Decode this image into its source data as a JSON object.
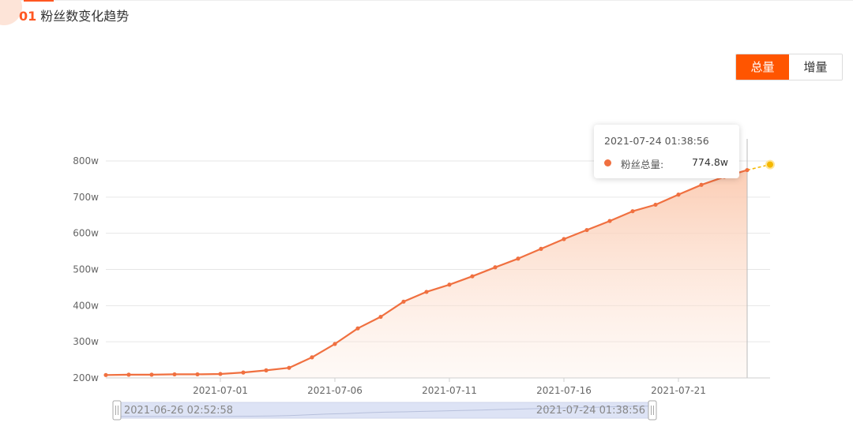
{
  "section": {
    "number": "01",
    "title": "粉丝数变化趋势"
  },
  "toggle": {
    "total_label": "总量",
    "increment_label": "增量",
    "active": "总量"
  },
  "tooltip": {
    "time": "2021-07-24 01:38:56",
    "series_name": "粉丝总量:",
    "value": "774.8w"
  },
  "datazoom": {
    "start_label": "2021-06-26 02:52:58",
    "end_label": "2021-07-24 01:38:56"
  },
  "colors": {
    "accent": "#ff5500",
    "line": "#f07040",
    "area_top": "#fbcab0",
    "highlight": "#f5b800"
  },
  "chart_data": {
    "type": "area",
    "title": "",
    "xlabel": "",
    "ylabel": "",
    "ylim": [
      200,
      800
    ],
    "y_ticks": [
      200,
      300,
      400,
      500,
      600,
      700,
      800
    ],
    "y_tick_labels": [
      "200w",
      "300w",
      "400w",
      "500w",
      "600w",
      "700w",
      "800w"
    ],
    "x_tick_labels": [
      "2021-07-01",
      "2021-07-06",
      "2021-07-11",
      "2021-07-16",
      "2021-07-21"
    ],
    "x_tick_days": [
      5,
      10,
      15,
      20,
      25
    ],
    "grid": true,
    "series": [
      {
        "name": "粉丝总量",
        "days": [
          0,
          1,
          2,
          3,
          4,
          5,
          6,
          7,
          8,
          9,
          10,
          11,
          12,
          13,
          14,
          15,
          16,
          17,
          18,
          19,
          20,
          21,
          22,
          23,
          24,
          25,
          26,
          27,
          28
        ],
        "values": [
          208,
          209,
          209,
          210,
          210,
          211,
          215,
          221,
          228,
          257,
          294,
          337,
          369,
          411,
          438,
          458,
          481,
          506,
          530,
          557,
          584,
          609,
          634,
          661,
          679,
          707,
          734,
          756,
          774.8
        ]
      }
    ],
    "highlight_point": {
      "day": 29,
      "value": 790
    }
  }
}
